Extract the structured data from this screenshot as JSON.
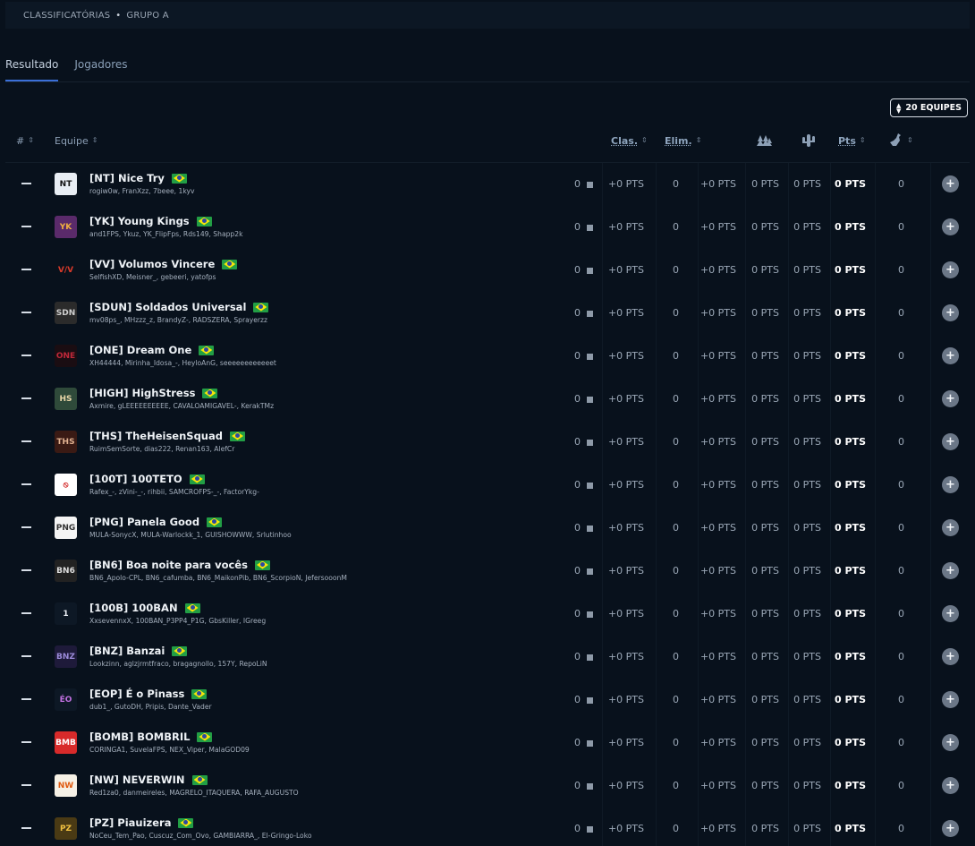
{
  "breadcrumb": {
    "part1": "CLASSIFICATÓRIAS",
    "separator": "•",
    "part2": "GRUPO A"
  },
  "tabs": [
    {
      "label": "Resultado",
      "active": true
    },
    {
      "label": "Jogadores",
      "active": false
    }
  ],
  "teams_button": {
    "icon": "sort-icon",
    "label": "20 EQUIPES"
  },
  "table": {
    "headers": {
      "rank": "#",
      "team": "Equipe",
      "clas": "Clas.",
      "elim": "Elim.",
      "pts": "Pts"
    },
    "rows": [
      {
        "rank_display": "",
        "tag_name": "[NT] Nice Try",
        "players": "rogiw0w, FranXzz, 7beee, 1kyv",
        "logo_text": "NT",
        "logo_color": "#e9eef4",
        "logo_fg": "#111111",
        "clas_count": "0",
        "clas_pts": "+0 PTS",
        "elim_count": "0",
        "elim_pts": "+0 PTS",
        "col_a": "0 PTS",
        "col_b": "0 PTS",
        "total": "0 PTS",
        "last": "0"
      },
      {
        "tag_name": "[YK] Young Kings",
        "players": "and1FPS, Ykuz, YK_FlipFps, Rds149, Shapp2k",
        "logo_text": "YK",
        "logo_color": "#5a2a6a",
        "logo_fg": "#f0b040",
        "clas_count": "0",
        "clas_pts": "+0 PTS",
        "elim_count": "0",
        "elim_pts": "+0 PTS",
        "col_a": "0 PTS",
        "col_b": "0 PTS",
        "total": "0 PTS",
        "last": "0"
      },
      {
        "tag_name": "[VV] Volumos Vincere",
        "players": "SelfishXD, Meisner_, gebeeri, yatofps",
        "logo_text": "V/V",
        "logo_color": "#08111c",
        "logo_fg": "#d83a2a",
        "clas_count": "0",
        "clas_pts": "+0 PTS",
        "elim_count": "0",
        "elim_pts": "+0 PTS",
        "col_a": "0 PTS",
        "col_b": "0 PTS",
        "total": "0 PTS",
        "last": "0"
      },
      {
        "tag_name": "[SDUN] Soldados Universal",
        "players": "mv08ps_, MHzzz_z, BrandyZ-, RADSZERA, Sprayerzz",
        "logo_text": "SDN",
        "logo_color": "#2b2b2b",
        "logo_fg": "#cfcfcf",
        "clas_count": "0",
        "clas_pts": "+0 PTS",
        "elim_count": "0",
        "elim_pts": "+0 PTS",
        "col_a": "0 PTS",
        "col_b": "0 PTS",
        "total": "0 PTS",
        "last": "0"
      },
      {
        "tag_name": "[ONE] Dream One",
        "players": "XH44444, Mirinha_Idosa_-, HeyloAnG, seeeeeeeeeeeet",
        "logo_text": "ONE",
        "logo_color": "#1a0d12",
        "logo_fg": "#c0283a",
        "clas_count": "0",
        "clas_pts": "+0 PTS",
        "elim_count": "0",
        "elim_pts": "+0 PTS",
        "col_a": "0 PTS",
        "col_b": "0 PTS",
        "total": "0 PTS",
        "last": "0"
      },
      {
        "tag_name": "[HIGH] HighStress",
        "players": "Axmire, gLEEEEEEEEEE, CAVALOAMIGAVEL-, KerakTMz",
        "logo_text": "HS",
        "logo_color": "#2f4a3a",
        "logo_fg": "#e8d6a8",
        "clas_count": "0",
        "clas_pts": "+0 PTS",
        "elim_count": "0",
        "elim_pts": "+0 PTS",
        "col_a": "0 PTS",
        "col_b": "0 PTS",
        "total": "0 PTS",
        "last": "0"
      },
      {
        "tag_name": "[THS] TheHeisenSquad",
        "players": "RuimSemSorte, dias222, Renan163, AlefCr",
        "logo_text": "THS",
        "logo_color": "#3a1a14",
        "logo_fg": "#e0b090",
        "clas_count": "0",
        "clas_pts": "+0 PTS",
        "elim_count": "0",
        "elim_pts": "+0 PTS",
        "col_a": "0 PTS",
        "col_b": "0 PTS",
        "total": "0 PTS",
        "last": "0"
      },
      {
        "tag_name": "[100T] 100TETO",
        "players": "Rafex_-, zVini-_-, rihbii, SAMCROFPS-_-, FactorYkg-",
        "logo_text": "⦸",
        "logo_color": "#ffffff",
        "logo_fg": "#d01818",
        "clas_count": "0",
        "clas_pts": "+0 PTS",
        "elim_count": "0",
        "elim_pts": "+0 PTS",
        "col_a": "0 PTS",
        "col_b": "0 PTS",
        "total": "0 PTS",
        "last": "0"
      },
      {
        "tag_name": "[PNG] Panela Good",
        "players": "MULA-SonycX, MULA-Warlockk_1, GUISHOWWW, Srlutinhoo",
        "logo_text": "PNG",
        "logo_color": "#f4f4f4",
        "logo_fg": "#333333",
        "clas_count": "0",
        "clas_pts": "+0 PTS",
        "elim_count": "0",
        "elim_pts": "+0 PTS",
        "col_a": "0 PTS",
        "col_b": "0 PTS",
        "total": "0 PTS",
        "last": "0"
      },
      {
        "tag_name": "[BN6] Boa noite para vocês",
        "players": "BN6_Apolo-CPL, BN6_cafumba, BN6_MaikonPib, BN6_ScorpioN, JefersooonM",
        "logo_text": "BN6",
        "logo_color": "#222222",
        "logo_fg": "#dddddd",
        "clas_count": "0",
        "clas_pts": "+0 PTS",
        "elim_count": "0",
        "elim_pts": "+0 PTS",
        "col_a": "0 PTS",
        "col_b": "0 PTS",
        "total": "0 PTS",
        "last": "0"
      },
      {
        "tag_name": "[100B] 100BAN",
        "players": "XxsevennxX, 100BAN_P3PP4_P1G, GbsKiller, IGreeg",
        "logo_text": "1",
        "logo_color": "#0d1825",
        "logo_fg": "#e9eef4",
        "clas_count": "0",
        "clas_pts": "+0 PTS",
        "elim_count": "0",
        "elim_pts": "+0 PTS",
        "col_a": "0 PTS",
        "col_b": "0 PTS",
        "total": "0 PTS",
        "last": "0"
      },
      {
        "tag_name": "[BNZ] Banzai",
        "players": "Lookzinn, aglzjrmtfraco, bragagnollo, 157Y, RepoLiN",
        "logo_text": "BNZ",
        "logo_color": "#1e1a3a",
        "logo_fg": "#9a8ad8",
        "clas_count": "0",
        "clas_pts": "+0 PTS",
        "elim_count": "0",
        "elim_pts": "+0 PTS",
        "col_a": "0 PTS",
        "col_b": "0 PTS",
        "total": "0 PTS",
        "last": "0"
      },
      {
        "tag_name": "[EOP] É o Pinass",
        "players": "dub1_, GutoDH, Pripis, Dante_Vader",
        "logo_text": "ÉO",
        "logo_color": "#0d1825",
        "logo_fg": "#c070e0",
        "clas_count": "0",
        "clas_pts": "+0 PTS",
        "elim_count": "0",
        "elim_pts": "+0 PTS",
        "col_a": "0 PTS",
        "col_b": "0 PTS",
        "total": "0 PTS",
        "last": "0"
      },
      {
        "tag_name": "[BOMB] BOMBRIL",
        "players": "CORINGA1, SuvelaFPS, NEX_Viper, MalaGOD09",
        "logo_text": "BMB",
        "logo_color": "#d82a2a",
        "logo_fg": "#ffffff",
        "clas_count": "0",
        "clas_pts": "+0 PTS",
        "elim_count": "0",
        "elim_pts": "+0 PTS",
        "col_a": "0 PTS",
        "col_b": "0 PTS",
        "total": "0 PTS",
        "last": "0"
      },
      {
        "tag_name": "[NW] NEVERWIN",
        "players": "Red1za0, danmeireles, MAGRELO_ITAQUERA, RAFA_AUGUSTO",
        "logo_text": "NW",
        "logo_color": "#f6f1e6",
        "logo_fg": "#e05a10",
        "clas_count": "0",
        "clas_pts": "+0 PTS",
        "elim_count": "0",
        "elim_pts": "+0 PTS",
        "col_a": "0 PTS",
        "col_b": "0 PTS",
        "total": "0 PTS",
        "last": "0"
      },
      {
        "tag_name": "[PZ] Piauizera",
        "players": "NoCeu_Tem_Pao, Cuscuz_Com_Ovo, GAMBIARRA_, El-Gringo-Loko",
        "logo_text": "PZ",
        "logo_color": "#4a3a14",
        "logo_fg": "#f0c040",
        "clas_count": "0",
        "clas_pts": "+0 PTS",
        "elim_count": "0",
        "elim_pts": "+0 PTS",
        "col_a": "0 PTS",
        "col_b": "0 PTS",
        "total": "0 PTS",
        "last": "0"
      }
    ]
  },
  "colors": {
    "background": "#08111c",
    "accent": "#3b6fd8",
    "flag": "brazil-flag-icon"
  }
}
